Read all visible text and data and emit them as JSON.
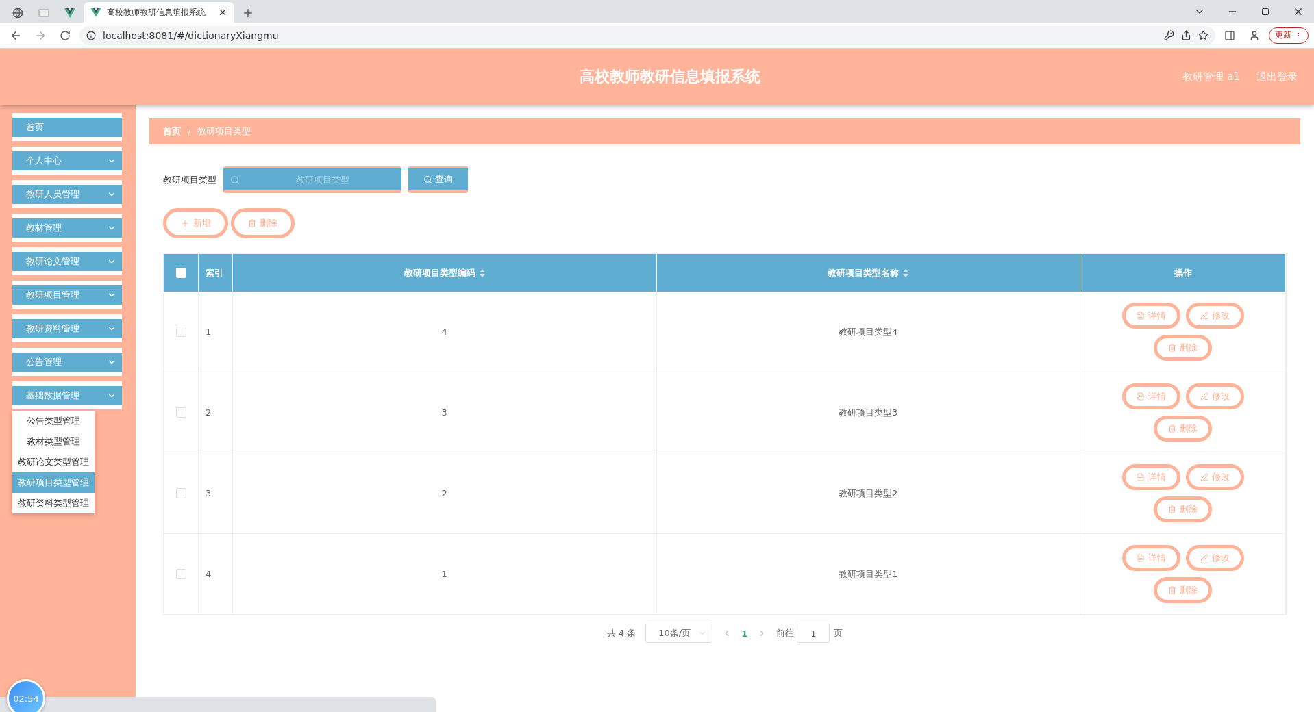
{
  "browser": {
    "tabs": [
      {
        "kind": "globe"
      },
      {
        "kind": "blank"
      },
      {
        "kind": "vue"
      },
      {
        "kind": "page",
        "title": "高校教师教研信息填报系统"
      }
    ],
    "url": "localhost:8081/#/dictionaryXiangmu",
    "update_button": "更新"
  },
  "header": {
    "title": "高校教师教研信息填报系统",
    "user": "教研管理 a1",
    "logout": "退出登录"
  },
  "sidebar": {
    "items": [
      {
        "label": "首页",
        "kind": "link"
      },
      {
        "label": "个人中心",
        "kind": "group"
      },
      {
        "label": "教研人员管理",
        "kind": "group"
      },
      {
        "label": "教材管理",
        "kind": "group"
      },
      {
        "label": "教研论文管理",
        "kind": "group"
      },
      {
        "label": "教研项目管理",
        "kind": "group"
      },
      {
        "label": "教研资料管理",
        "kind": "group"
      },
      {
        "label": "公告管理",
        "kind": "group"
      },
      {
        "label": "基础数据管理",
        "kind": "group"
      }
    ],
    "submenu": [
      {
        "label": "公告类型管理",
        "selected": false
      },
      {
        "label": "教材类型管理",
        "selected": false
      },
      {
        "label": "教研论文类型管理",
        "selected": false
      },
      {
        "label": "教研项目类型管理",
        "selected": true
      },
      {
        "label": "教研资料类型管理",
        "selected": false
      }
    ]
  },
  "breadcrumb": {
    "items": [
      "首页",
      "教研项目类型"
    ],
    "separator": "/"
  },
  "search": {
    "label": "教研项目类型",
    "placeholder": "教研项目类型",
    "button": "查询"
  },
  "actions": {
    "add": "新增",
    "delete": "删除"
  },
  "table": {
    "select_all_checked": false,
    "columns": [
      {
        "label": "索引",
        "sortable": false
      },
      {
        "label": "教研项目类型编码",
        "sortable": true
      },
      {
        "label": "教研项目类型名称",
        "sortable": true
      },
      {
        "label": "操作",
        "sortable": false
      }
    ],
    "rows": [
      {
        "index": "1",
        "code": "4",
        "name": "教研项目类型4",
        "checked": false,
        "buttons": {
          "detail": "详情",
          "edit": "修改",
          "delete": "删除"
        }
      },
      {
        "index": "2",
        "code": "3",
        "name": "教研项目类型3",
        "checked": false,
        "buttons": {
          "detail": "详情",
          "edit": "修改",
          "delete": "删除"
        }
      },
      {
        "index": "3",
        "code": "2",
        "name": "教研项目类型2",
        "checked": false,
        "buttons": {
          "detail": "详情",
          "edit": "修改",
          "delete": "删除"
        }
      },
      {
        "index": "4",
        "code": "1",
        "name": "教研项目类型1",
        "checked": false,
        "buttons": {
          "detail": "详情",
          "edit": "修改",
          "delete": "删除"
        }
      }
    ]
  },
  "pagination": {
    "total": "共 4 条",
    "page_size": "10条/页",
    "pages": [
      {
        "label": "1",
        "selected": true
      }
    ],
    "goto_label": "前往",
    "goto_value": "1",
    "goto_suffix": "页"
  },
  "timer": "02:54"
}
